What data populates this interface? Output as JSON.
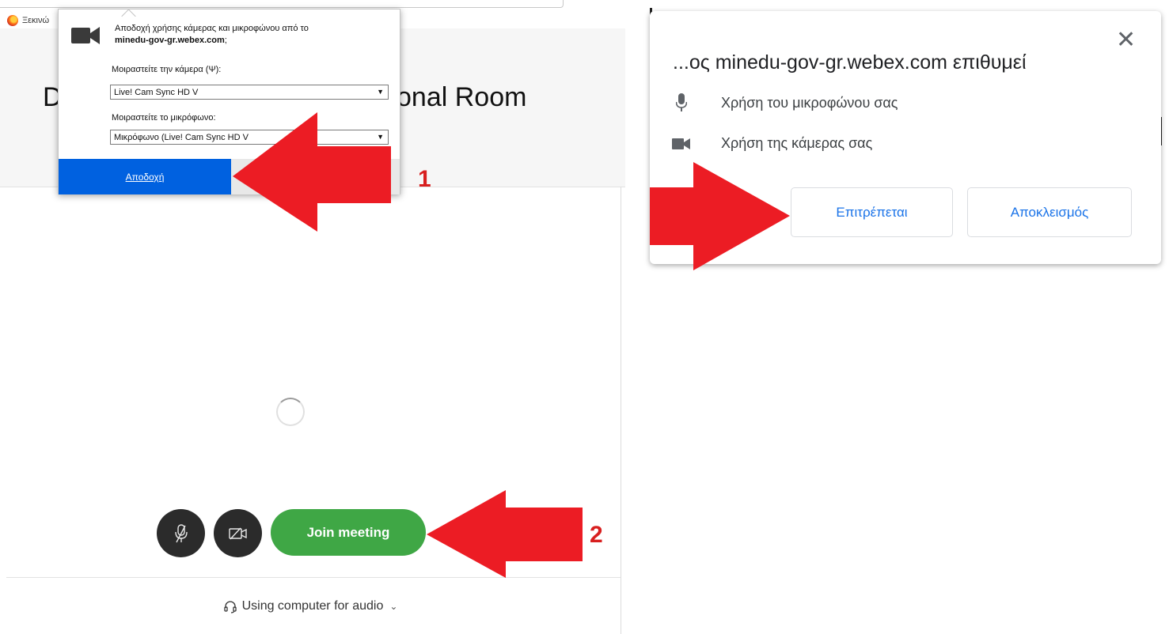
{
  "firefox": {
    "bookmark": "Ξεκινώ",
    "popup": {
      "question": "Αποδοχή χρήσης κάμερας και μικροφώνου από το",
      "domain": "minedu-gov-gr.webex.com",
      "question_tail": ";",
      "camera_label": "Μοιραστείτε την κάμερα (Ψ):",
      "camera_value": "Live! Cam Sync HD V",
      "mic_label": "Μοιραστείτε το μικρόφωνο:",
      "mic_value": "Μικρόφωνο (Live! Cam Sync HD V",
      "mic_value_tail": ")",
      "accept_label": "Αποδοχή"
    }
  },
  "webex": {
    "room_title_start": "D",
    "room_title_end": "onal Room",
    "join_label": "Join meeting",
    "audio_label": "Using computer for audio"
  },
  "chrome": {
    "title": "...ος minedu-gov-gr.webex.com επιθυμεί",
    "close": "✕",
    "mic_permission": "Χρήση του μικροφώνου σας",
    "camera_permission": "Χρήση της κάμερας σας",
    "allow_label": "Επιτρέπεται",
    "block_label": "Αποκλεισμός"
  },
  "steps": {
    "step1": "1",
    "step2": "2"
  },
  "colors": {
    "annotation_red": "#ec1c24",
    "firefox_accept_blue": "#0061e0",
    "join_green": "#3fa745",
    "chrome_button_blue": "#1a73e8"
  }
}
